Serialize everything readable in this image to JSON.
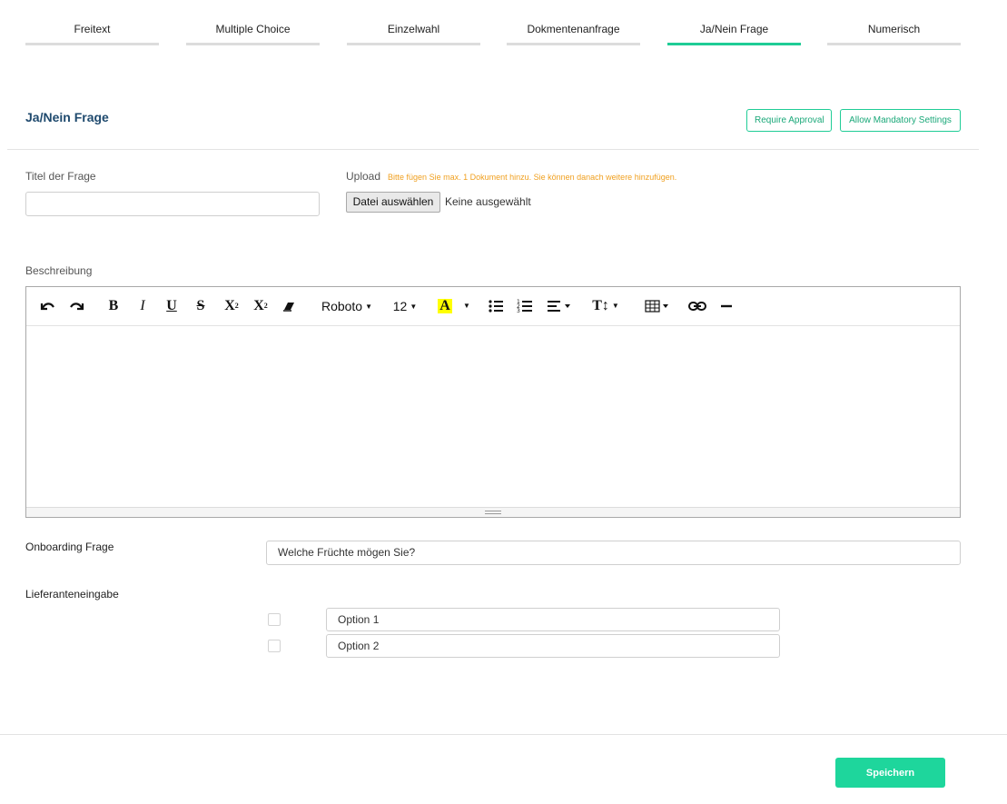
{
  "tabs": [
    {
      "label": "Freitext"
    },
    {
      "label": "Multiple Choice"
    },
    {
      "label": "Einzelwahl"
    },
    {
      "label": "Dokmentenanfrage"
    },
    {
      "label": "Ja/Nein Frage"
    },
    {
      "label": "Numerisch"
    }
  ],
  "active_tab": "Ja/Nein Frage",
  "section": {
    "title": "Ja/Nein Frage",
    "require_approval_label": "Require Approval",
    "allow_mandatory_label": "Allow Mandatory Settings"
  },
  "form": {
    "title_label": "Titel der Frage",
    "title_value": "",
    "upload_label": "Upload",
    "upload_hint": "Bitte fügen Sie max. 1 Dokument hinzu. Sie können danach weitere hinzufügen.",
    "file_button_label": "Datei auswählen",
    "file_status": "Keine ausgewählt",
    "description_label": "Beschreibung"
  },
  "editor": {
    "font_name": "Roboto",
    "font_size": "12",
    "style_label": "T↕",
    "tools": [
      "undo",
      "redo",
      "bold",
      "italic",
      "underline",
      "strikethrough",
      "superscript",
      "subscript",
      "eraser",
      "font-family",
      "font-size",
      "highlight-color",
      "unordered-list",
      "ordered-list",
      "align",
      "line-height",
      "table",
      "link",
      "horizontal-rule"
    ],
    "content": ""
  },
  "onboarding": {
    "label": "Onboarding Frage",
    "value": "Welche Früchte mögen Sie?"
  },
  "supplier_input": {
    "label": "Lieferanteneingabe",
    "options": [
      {
        "value": "Option 1",
        "checked": false
      },
      {
        "value": "Option 2",
        "checked": false
      }
    ]
  },
  "footer": {
    "save_label": "Speichern"
  },
  "colors": {
    "accent": "#1fcc96",
    "title_blue": "#1f4a6e",
    "hint_orange": "#f0a020",
    "save_button": "#1ed69c"
  }
}
